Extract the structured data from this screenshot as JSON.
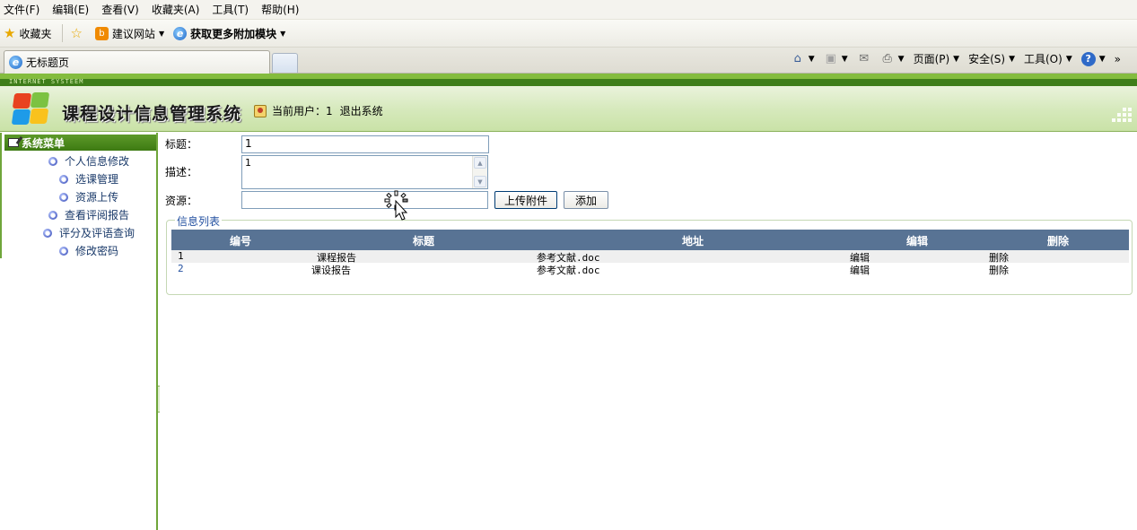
{
  "browser": {
    "menu": [
      "文件(F)",
      "编辑(E)",
      "查看(V)",
      "收藏夹(A)",
      "工具(T)",
      "帮助(H)"
    ],
    "favorites": {
      "favorites_label": "收藏夹",
      "suggested_sites": "建议网站",
      "get_addons": "获取更多附加模块"
    },
    "tab_title": "无标题页",
    "commands": {
      "page": "页面(P)",
      "safety": "安全(S)",
      "tools": "工具(O)"
    }
  },
  "app": {
    "banner_small": "INTERNET SYSTEEM",
    "title": "课程设计信息管理系统",
    "current_user_label": "当前用户：",
    "current_user": "1",
    "logout": "退出系统"
  },
  "sidebar": {
    "heading": "系统菜单",
    "items": [
      {
        "label": "个人信息修改"
      },
      {
        "label": "选课管理"
      },
      {
        "label": "资源上传"
      },
      {
        "label": "查看评阅报告"
      },
      {
        "label": "评分及评语查询"
      },
      {
        "label": "修改密码"
      }
    ]
  },
  "form": {
    "title_label": "标题：",
    "title_value": "1",
    "desc_label": "描述：",
    "desc_value": "1",
    "resource_label": "资源：",
    "resource_value": "",
    "upload_button": "上传附件",
    "add_button": "添加"
  },
  "list": {
    "legend": "信息列表",
    "columns": [
      "编号",
      "标题",
      "地址",
      "编辑",
      "删除"
    ],
    "rows": [
      {
        "id": "1",
        "title": "课程报告",
        "address": "参考文献.doc",
        "edit": "编辑",
        "delete": "删除"
      },
      {
        "id": "2",
        "title": "课设报告",
        "address": "参考文献.doc",
        "edit": "编辑",
        "delete": "删除"
      }
    ]
  },
  "colors": {
    "header_green": "#3f7e1a",
    "table_header": "#587394",
    "link_blue": "#2350a0"
  }
}
